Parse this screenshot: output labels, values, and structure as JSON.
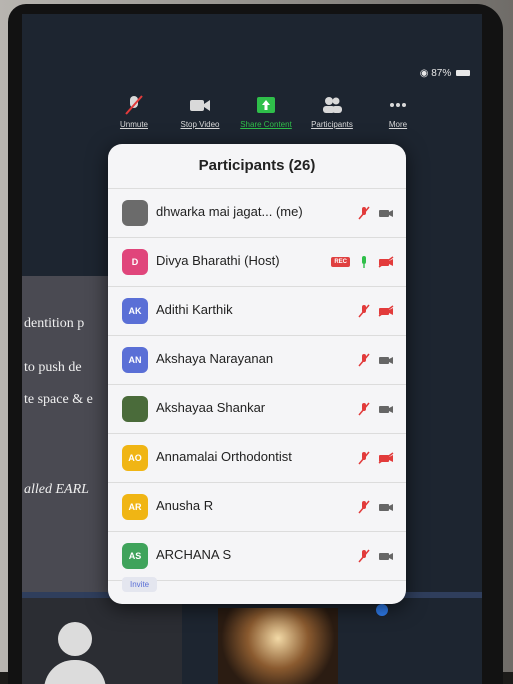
{
  "status": {
    "battery": "87%"
  },
  "toolbar": [
    {
      "label": "Unmute",
      "icon": "mic-muted-icon"
    },
    {
      "label": "Stop Video",
      "icon": "camera-icon"
    },
    {
      "label": "Share Content",
      "icon": "share-arrow-icon"
    },
    {
      "label": "Participants",
      "icon": "people-icon"
    },
    {
      "label": "More",
      "icon": "more-dots-icon"
    }
  ],
  "slide_lines": [
    "dentition p",
    "to push de",
    "te space & e",
    "alled EARL"
  ],
  "panel": {
    "title": "Participants (26)",
    "participants": [
      {
        "name": "dhwarka mai jagat...  (me)",
        "initials": "",
        "color": "#6b6b6b",
        "mic": "muted",
        "video": "on",
        "rec": false
      },
      {
        "name": "Divya Bharathi (Host)",
        "initials": "D",
        "color": "#e0457b",
        "mic": "on",
        "video": "off",
        "rec": true,
        "rec_label": "REC"
      },
      {
        "name": "Adithi Karthik",
        "initials": "AK",
        "color": "#5a6fd6",
        "mic": "muted",
        "video": "off",
        "rec": false
      },
      {
        "name": "Akshaya Narayanan",
        "initials": "AN",
        "color": "#5a6fd6",
        "mic": "muted",
        "video": "on",
        "rec": false
      },
      {
        "name": "Akshayaa Shankar",
        "initials": "",
        "color": "#4a6b3a",
        "mic": "muted",
        "video": "on",
        "rec": false
      },
      {
        "name": "Annamalai Orthodontist",
        "initials": "AO",
        "color": "#f0b514",
        "mic": "muted",
        "video": "off",
        "rec": false
      },
      {
        "name": "Anusha R",
        "initials": "AR",
        "color": "#f0b514",
        "mic": "muted",
        "video": "on",
        "rec": false
      },
      {
        "name": "ARCHANA S",
        "initials": "AS",
        "color": "#3fa35b",
        "mic": "muted",
        "video": "on",
        "rec": false
      }
    ],
    "invite_label": "Invite"
  },
  "colors": {
    "muted_red": "#e23b3b",
    "active_green": "#2fbf4a",
    "grey_icon": "#666666"
  }
}
